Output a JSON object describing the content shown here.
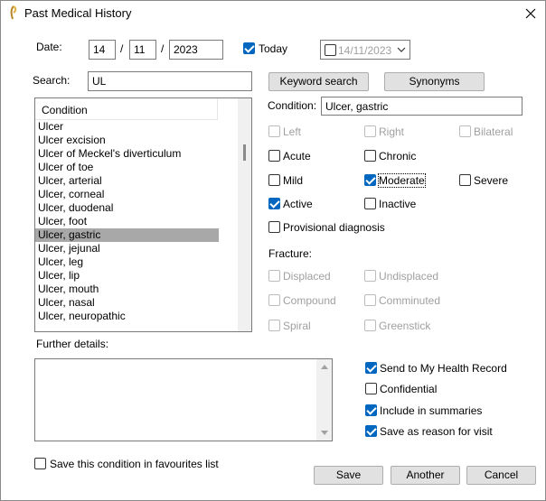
{
  "window": {
    "title": "Past Medical History"
  },
  "date": {
    "label": "Date:",
    "day": "14",
    "month": "11",
    "year": "2023",
    "separator": "/",
    "today_label": "Today",
    "today_checked": true,
    "picker_value": "14/11/2023",
    "picker_checked": false
  },
  "search": {
    "label": "Search:",
    "value": "UL",
    "keyword_button": "Keyword search",
    "synonyms_button": "Synonyms"
  },
  "condition_list": {
    "header": "Condition",
    "items": [
      "Ulcer",
      "Ulcer excision",
      "Ulcer of Meckel's diverticulum",
      "Ulcer of toe",
      "Ulcer, arterial",
      "Ulcer, corneal",
      "Ulcer, duodenal",
      "Ulcer, foot",
      "Ulcer, gastric",
      "Ulcer, jejunal",
      "Ulcer, leg",
      "Ulcer, lip",
      "Ulcer, mouth",
      "Ulcer, nasal",
      "Ulcer, neuropathic"
    ],
    "selected_index": 8
  },
  "condition": {
    "label": "Condition:",
    "value": "Ulcer, gastric"
  },
  "options": {
    "left": {
      "label": "Left",
      "checked": false,
      "enabled": false
    },
    "right": {
      "label": "Right",
      "checked": false,
      "enabled": false
    },
    "bilateral": {
      "label": "Bilateral",
      "checked": false,
      "enabled": false
    },
    "acute": {
      "label": "Acute",
      "checked": false,
      "enabled": true
    },
    "chronic": {
      "label": "Chronic",
      "checked": false,
      "enabled": true
    },
    "mild": {
      "label": "Mild",
      "checked": false,
      "enabled": true
    },
    "moderate": {
      "label": "Moderate",
      "checked": true,
      "enabled": true
    },
    "severe": {
      "label": "Severe",
      "checked": false,
      "enabled": true
    },
    "active": {
      "label": "Active",
      "checked": true,
      "enabled": true
    },
    "inactive": {
      "label": "Inactive",
      "checked": false,
      "enabled": true
    },
    "provisional": {
      "label": "Provisional diagnosis",
      "checked": false,
      "enabled": true
    }
  },
  "fracture": {
    "label": "Fracture:",
    "displaced": "Displaced",
    "undisplaced": "Undisplaced",
    "compound": "Compound",
    "comminuted": "Comminuted",
    "spiral": "Spiral",
    "greenstick": "Greenstick"
  },
  "further_details": {
    "label": "Further details:",
    "value": ""
  },
  "flags": {
    "send_mhr": {
      "label": "Send to My Health Record",
      "checked": true
    },
    "confidential": {
      "label": "Confidential",
      "checked": false
    },
    "include_summaries": {
      "label": "Include in summaries",
      "checked": true
    },
    "reason_for_visit": {
      "label": "Save as reason for visit",
      "checked": true
    }
  },
  "favourites": {
    "label": "Save this condition in favourites list",
    "checked": false
  },
  "buttons": {
    "save": "Save",
    "another": "Another",
    "cancel": "Cancel"
  },
  "colors": {
    "accent": "#0067c0",
    "selection": "#a8a8a8",
    "button_face": "#e1e1e1"
  }
}
